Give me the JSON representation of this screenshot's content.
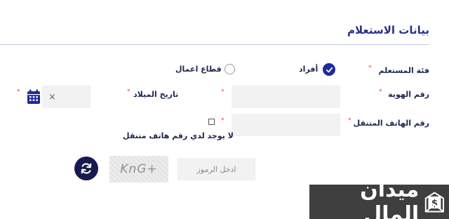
{
  "page": {
    "title": "بيانات الاستعلام"
  },
  "category": {
    "label": "فئة المستعلم",
    "required_mark": "*",
    "options": [
      {
        "label": "أفراد",
        "selected": true
      },
      {
        "label": "قطاع اعمال",
        "selected": false
      }
    ]
  },
  "id_number": {
    "label": "رقم الهوية",
    "required_mark": "*",
    "value": ""
  },
  "birth_date": {
    "label": "تاريخ الميلاد",
    "required_mark": "*",
    "value": "",
    "clear_symbol": "×",
    "calendar_icon": "calendar-icon"
  },
  "mobile": {
    "label": "رقم الهاتف المتنقل",
    "required_mark": "*",
    "value": "",
    "no_mobile_checkbox": {
      "checked": false,
      "required_mark": "*",
      "label": "لا يوجد لدي رقم هاتف متنقل"
    }
  },
  "captcha": {
    "placeholder": "ادخل الرموز",
    "image_text": "KnG+",
    "refresh_icon": "refresh-icon"
  },
  "watermark": {
    "text": "ميدان المال",
    "logo_icon": "mail-dollar-icon"
  },
  "colors": {
    "accent": "#1e2b9a",
    "dark": "#161a4f",
    "required": "#e04a5a",
    "input_bg": "#f2f2f2"
  }
}
